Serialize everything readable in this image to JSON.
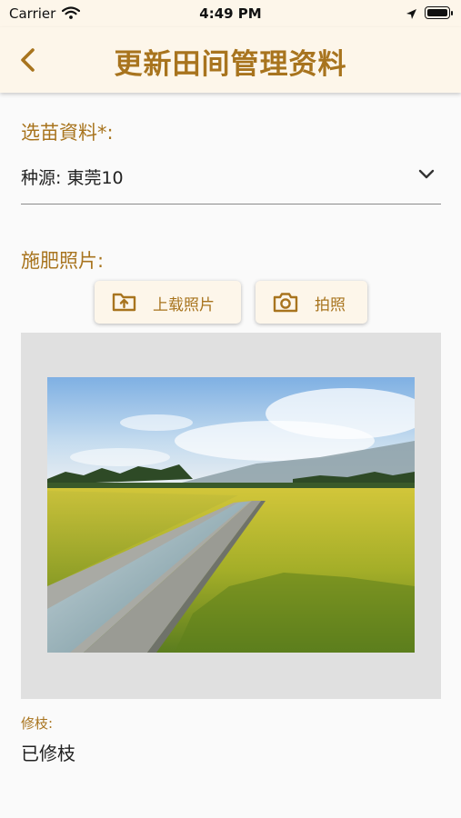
{
  "status_bar": {
    "carrier": "Carrier",
    "time": "4:49 PM",
    "icons": [
      "wifi-icon",
      "location-arrow-icon",
      "battery-icon"
    ]
  },
  "nav": {
    "back_icon": "chevron-left-icon",
    "title": "更新田间管理资料"
  },
  "seedling": {
    "label": "选苗資料*:",
    "value": "种源: 東莞10",
    "dropdown_icon": "chevron-down-icon"
  },
  "fertilizer_photo": {
    "label": "施肥照片:",
    "upload_button": {
      "label": "上载照片",
      "icon": "upload-folder-icon"
    },
    "camera_button": {
      "label": "拍照",
      "icon": "camera-icon"
    },
    "image_subject": "rice-paddy-field-with-irrigation-canal"
  },
  "pruning": {
    "label": "修枝:",
    "value": "已修枝"
  },
  "colors": {
    "accent": "#a8741e",
    "header_bg": "#fdf6ea",
    "page_bg": "#fafafa",
    "panel_bg": "#e0e0e0"
  }
}
